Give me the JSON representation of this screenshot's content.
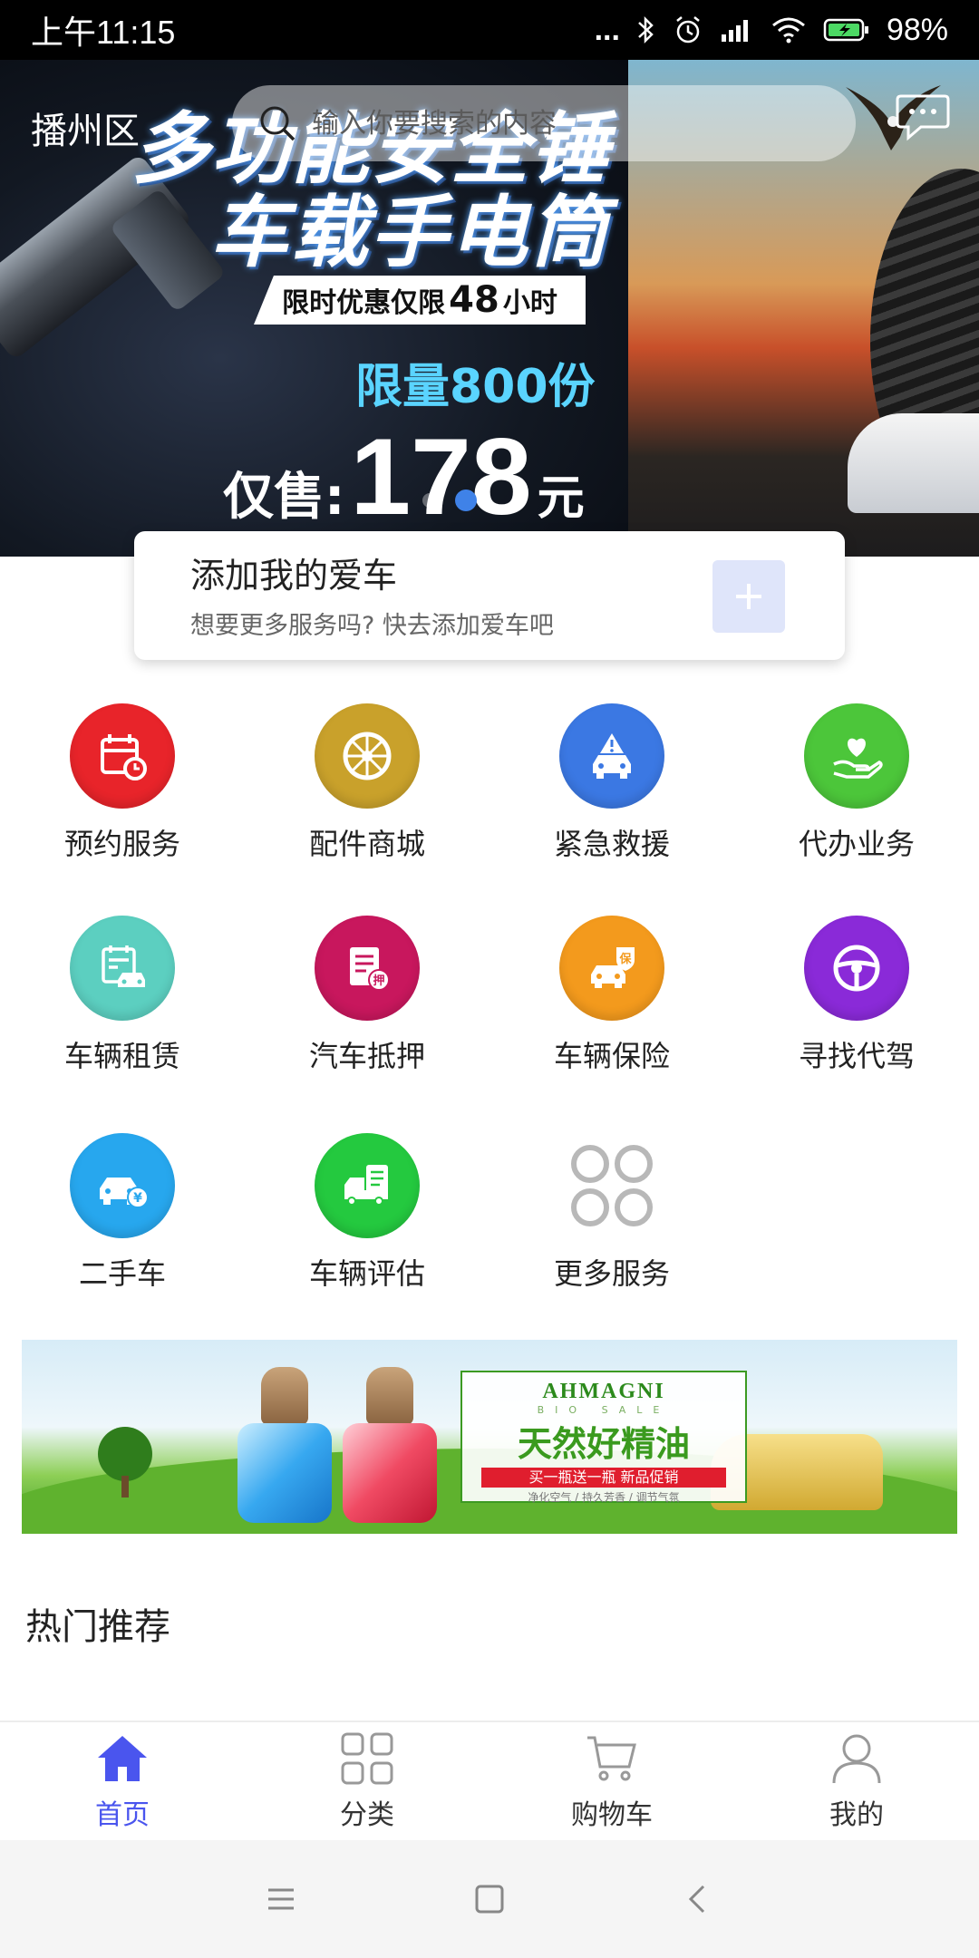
{
  "status_bar": {
    "time": "上午11:15",
    "signal_dots": "...",
    "battery": "98%"
  },
  "header": {
    "location": "播州区",
    "search_placeholder": "输入你要搜索的内容"
  },
  "hero": {
    "title_line1": "多功能安全锤",
    "title_line2": "车载手电筒",
    "tag_prefix": "限时优惠仅限 ",
    "tag_hours": "48",
    "tag_suffix": " 小时",
    "limit": "限量800份",
    "price_label": "仅售:",
    "price_value": "178",
    "price_unit": "元",
    "active_slide": 2,
    "slide_count": 2
  },
  "add_car": {
    "title": "添加我的爱车",
    "subtitle": "想要更多服务吗? 快去添加爱车吧"
  },
  "services": [
    {
      "label": "预约服务",
      "icon": "calendar-clock-icon",
      "color": "#e8242a"
    },
    {
      "label": "配件商城",
      "icon": "wheel-icon",
      "color": "#c9a12b"
    },
    {
      "label": "紧急救援",
      "icon": "car-warning-icon",
      "color": "#3b78e3"
    },
    {
      "label": "代办业务",
      "icon": "hand-heart-icon",
      "color": "#4cc63a"
    },
    {
      "label": "车辆租赁",
      "icon": "car-calendar-icon",
      "color": "#5ccfc0"
    },
    {
      "label": "汽车抵押",
      "icon": "mortgage-doc-icon",
      "color": "#c8175d"
    },
    {
      "label": "车辆保险",
      "icon": "car-insurance-icon",
      "color": "#f39a1d"
    },
    {
      "label": "寻找代驾",
      "icon": "steering-wheel-icon",
      "color": "#8a2ad8"
    },
    {
      "label": "二手车",
      "icon": "car-yen-icon",
      "color": "#27a7ee"
    },
    {
      "label": "车辆评估",
      "icon": "truck-clipboard-icon",
      "color": "#24c93f"
    },
    {
      "label": "更多服务",
      "icon": "more-grid-icon",
      "color": "#b8b8b8"
    }
  ],
  "promo": {
    "brand": "AHMAGNI",
    "sub_en": "BIO SALE",
    "title": "天然好精油",
    "strip": "买一瓶送一瓶 新品促销",
    "note": "净化空气 / 持久芳香 / 调节气氛"
  },
  "section": {
    "title": "热门推荐"
  },
  "tabs": [
    {
      "label": "首页",
      "icon": "home-icon",
      "active": true
    },
    {
      "label": "分类",
      "icon": "category-grid-icon",
      "active": false
    },
    {
      "label": "购物车",
      "icon": "cart-icon",
      "active": false
    },
    {
      "label": "我的",
      "icon": "user-icon",
      "active": false
    }
  ],
  "colors": {
    "accent": "#4a55ee",
    "add_button_bg": "#dfe5fa"
  }
}
